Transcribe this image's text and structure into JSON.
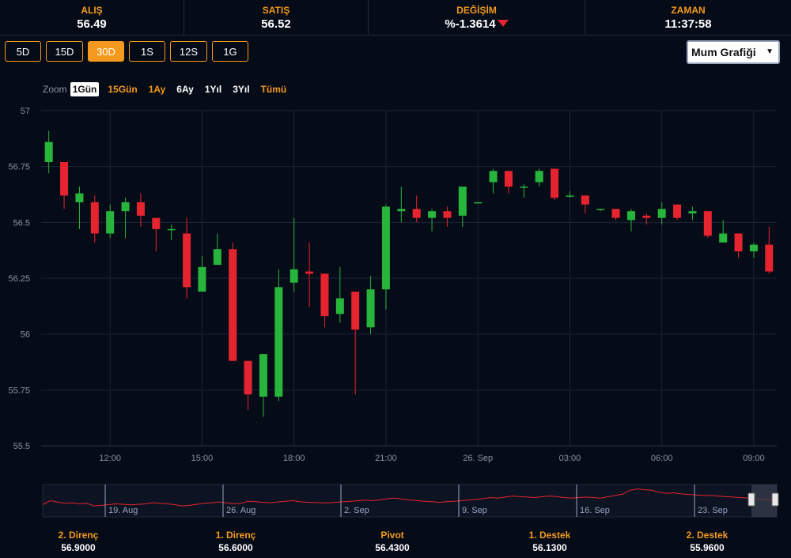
{
  "header": {
    "bid": {
      "label": "ALIŞ",
      "value": "56.49"
    },
    "ask": {
      "label": "SATIŞ",
      "value": "56.52"
    },
    "change": {
      "label": "DEĞİŞİM",
      "value": "%-1.3614"
    },
    "time": {
      "label": "ZAMAN",
      "value": "11:37:58"
    }
  },
  "range_buttons": [
    "5D",
    "15D",
    "30D",
    "1S",
    "12S",
    "1G"
  ],
  "active_range": "30D",
  "chart_type_select": {
    "value": "Mum Grafiği"
  },
  "zoom": {
    "label": "Zoom",
    "options": [
      "1Gün",
      "15Gün",
      "1Ay",
      "6Ay",
      "1Yıl",
      "3Yıl",
      "Tümü"
    ],
    "active": "1Gün"
  },
  "colors": {
    "up": "#27b53c",
    "down": "#e6242f",
    "accent": "#f39a1e",
    "background": "#060b18",
    "navigator_line": "#e6242f"
  },
  "chart_data": {
    "type": "candlestick",
    "y_ticks": [
      "57",
      "56.75",
      "56.5",
      "56.25",
      "56",
      "55.75",
      "55.5"
    ],
    "ylim": [
      55.5,
      57
    ],
    "x_ticks": [
      {
        "label": "12:00",
        "at": 4.5
      },
      {
        "label": "15:00",
        "at": 10.5
      },
      {
        "label": "18:00",
        "at": 16.5
      },
      {
        "label": "21:00",
        "at": 22.5
      },
      {
        "label": "26. Sep",
        "at": 28.5
      },
      {
        "label": "03:00",
        "at": 34.5
      },
      {
        "label": "06:00",
        "at": 40.5
      },
      {
        "label": "09:00",
        "at": 46.5
      }
    ],
    "candles": [
      {
        "o": 56.77,
        "h": 56.91,
        "l": 56.72,
        "c": 56.86
      },
      {
        "o": 56.77,
        "h": 56.77,
        "l": 56.56,
        "c": 56.62
      },
      {
        "o": 56.59,
        "h": 56.66,
        "l": 56.47,
        "c": 56.63
      },
      {
        "o": 56.59,
        "h": 56.62,
        "l": 56.41,
        "c": 56.45
      },
      {
        "o": 56.45,
        "h": 56.58,
        "l": 56.43,
        "c": 56.55
      },
      {
        "o": 56.55,
        "h": 56.61,
        "l": 56.43,
        "c": 56.59
      },
      {
        "o": 56.59,
        "h": 56.63,
        "l": 56.48,
        "c": 56.53
      },
      {
        "o": 56.52,
        "h": 56.52,
        "l": 56.37,
        "c": 56.47
      },
      {
        "o": 56.47,
        "h": 56.49,
        "l": 56.42,
        "c": 56.47
      },
      {
        "o": 56.45,
        "h": 56.52,
        "l": 56.16,
        "c": 56.21
      },
      {
        "o": 56.19,
        "h": 56.35,
        "l": 56.19,
        "c": 56.3
      },
      {
        "o": 56.31,
        "h": 56.45,
        "l": 56.31,
        "c": 56.38
      },
      {
        "o": 56.38,
        "h": 56.41,
        "l": 56.21,
        "c": 55.88
      },
      {
        "o": 55.88,
        "h": 55.88,
        "l": 55.66,
        "c": 55.73
      },
      {
        "o": 55.72,
        "h": 55.91,
        "l": 55.63,
        "c": 55.91
      },
      {
        "o": 55.72,
        "h": 56.29,
        "l": 55.7,
        "c": 56.21
      },
      {
        "o": 56.23,
        "h": 56.52,
        "l": 56.19,
        "c": 56.29
      },
      {
        "o": 56.28,
        "h": 56.41,
        "l": 56.12,
        "c": 56.27
      },
      {
        "o": 56.27,
        "h": 56.27,
        "l": 56.03,
        "c": 56.08
      },
      {
        "o": 56.09,
        "h": 56.3,
        "l": 56.05,
        "c": 56.16
      },
      {
        "o": 56.19,
        "h": 56.19,
        "l": 55.73,
        "c": 56.02
      },
      {
        "o": 56.03,
        "h": 56.26,
        "l": 56.0,
        "c": 56.2
      },
      {
        "o": 56.2,
        "h": 56.58,
        "l": 56.11,
        "c": 56.57
      },
      {
        "o": 56.55,
        "h": 56.66,
        "l": 56.5,
        "c": 56.56
      },
      {
        "o": 56.56,
        "h": 56.62,
        "l": 56.5,
        "c": 56.52
      },
      {
        "o": 56.52,
        "h": 56.56,
        "l": 56.46,
        "c": 56.55
      },
      {
        "o": 56.55,
        "h": 56.57,
        "l": 56.48,
        "c": 56.52
      },
      {
        "o": 56.53,
        "h": 56.66,
        "l": 56.48,
        "c": 56.66
      },
      {
        "o": 56.59,
        "h": 56.59,
        "l": 56.59,
        "c": 56.59
      },
      {
        "o": 56.68,
        "h": 56.74,
        "l": 56.63,
        "c": 56.73
      },
      {
        "o": 56.73,
        "h": 56.73,
        "l": 56.63,
        "c": 56.66
      },
      {
        "o": 56.66,
        "h": 56.67,
        "l": 56.61,
        "c": 56.66
      },
      {
        "o": 56.68,
        "h": 56.74,
        "l": 56.66,
        "c": 56.73
      },
      {
        "o": 56.74,
        "h": 56.74,
        "l": 56.6,
        "c": 56.61
      },
      {
        "o": 56.62,
        "h": 56.64,
        "l": 56.61,
        "c": 56.62
      },
      {
        "o": 56.62,
        "h": 56.62,
        "l": 56.54,
        "c": 56.58
      },
      {
        "o": 56.56,
        "h": 56.56,
        "l": 56.55,
        "c": 56.56
      },
      {
        "o": 56.56,
        "h": 56.56,
        "l": 56.51,
        "c": 56.52
      },
      {
        "o": 56.51,
        "h": 56.56,
        "l": 56.46,
        "c": 56.55
      },
      {
        "o": 56.53,
        "h": 56.54,
        "l": 56.49,
        "c": 56.52
      },
      {
        "o": 56.52,
        "h": 56.59,
        "l": 56.49,
        "c": 56.56
      },
      {
        "o": 56.58,
        "h": 56.58,
        "l": 56.51,
        "c": 56.52
      },
      {
        "o": 56.54,
        "h": 56.57,
        "l": 56.51,
        "c": 56.55
      },
      {
        "o": 56.55,
        "h": 56.55,
        "l": 56.43,
        "c": 56.44
      },
      {
        "o": 56.41,
        "h": 56.51,
        "l": 56.41,
        "c": 56.45
      },
      {
        "o": 56.45,
        "h": 56.45,
        "l": 56.34,
        "c": 56.37
      },
      {
        "o": 56.37,
        "h": 56.41,
        "l": 56.34,
        "c": 56.4
      },
      {
        "o": 56.4,
        "h": 56.48,
        "l": 56.27,
        "c": 56.28
      }
    ]
  },
  "navigator": {
    "labels": [
      "19. Aug",
      "26. Aug",
      "2. Sep",
      "9. Sep",
      "16. Sep",
      "23. Sep"
    ],
    "line": [
      0.35,
      0.5,
      0.45,
      0.4,
      0.42,
      0.38,
      0.4,
      0.3,
      0.32,
      0.35,
      0.38,
      0.36,
      0.34,
      0.36,
      0.38,
      0.42,
      0.4,
      0.38,
      0.35,
      0.3,
      0.32,
      0.36,
      0.4,
      0.42,
      0.45,
      0.42,
      0.38,
      0.4,
      0.48,
      0.46,
      0.44,
      0.42,
      0.45,
      0.48,
      0.5,
      0.46,
      0.44,
      0.43,
      0.42,
      0.42,
      0.44,
      0.46,
      0.48,
      0.5,
      0.52,
      0.5,
      0.54,
      0.58,
      0.6,
      0.56,
      0.52,
      0.5,
      0.48,
      0.46,
      0.44,
      0.46,
      0.48,
      0.5,
      0.52,
      0.55,
      0.58,
      0.62,
      0.6,
      0.64,
      0.68,
      0.66,
      0.64,
      0.62,
      0.65,
      0.68,
      0.66,
      0.62,
      0.6,
      0.62,
      0.64,
      0.62,
      0.6,
      0.65,
      0.7,
      0.75,
      0.9,
      0.95,
      0.92,
      0.9,
      0.82,
      0.78,
      0.8,
      0.76,
      0.74,
      0.72,
      0.7,
      0.7,
      0.68,
      0.66,
      0.64,
      0.62,
      0.6,
      0.58,
      0.56,
      0.52,
      0.5
    ]
  },
  "pivots": [
    {
      "label": "2. Direnç",
      "value": "56.9000"
    },
    {
      "label": "1. Direnç",
      "value": "56.6000"
    },
    {
      "label": "Pivot",
      "value": "56.4300"
    },
    {
      "label": "1. Destek",
      "value": "56.1300"
    },
    {
      "label": "2. Destek",
      "value": "55.9600"
    }
  ]
}
